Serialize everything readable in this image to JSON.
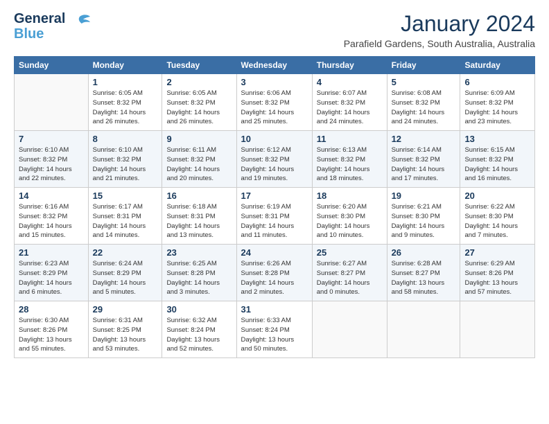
{
  "header": {
    "logo_line1": "General",
    "logo_line2": "Blue",
    "month": "January 2024",
    "location": "Parafield Gardens, South Australia, Australia"
  },
  "columns": [
    "Sunday",
    "Monday",
    "Tuesday",
    "Wednesday",
    "Thursday",
    "Friday",
    "Saturday"
  ],
  "weeks": [
    [
      {
        "day": "",
        "sunrise": "",
        "sunset": "",
        "daylight": ""
      },
      {
        "day": "1",
        "sunrise": "Sunrise: 6:05 AM",
        "sunset": "Sunset: 8:32 PM",
        "daylight": "Daylight: 14 hours and 26 minutes."
      },
      {
        "day": "2",
        "sunrise": "Sunrise: 6:05 AM",
        "sunset": "Sunset: 8:32 PM",
        "daylight": "Daylight: 14 hours and 26 minutes."
      },
      {
        "day": "3",
        "sunrise": "Sunrise: 6:06 AM",
        "sunset": "Sunset: 8:32 PM",
        "daylight": "Daylight: 14 hours and 25 minutes."
      },
      {
        "day": "4",
        "sunrise": "Sunrise: 6:07 AM",
        "sunset": "Sunset: 8:32 PM",
        "daylight": "Daylight: 14 hours and 24 minutes."
      },
      {
        "day": "5",
        "sunrise": "Sunrise: 6:08 AM",
        "sunset": "Sunset: 8:32 PM",
        "daylight": "Daylight: 14 hours and 24 minutes."
      },
      {
        "day": "6",
        "sunrise": "Sunrise: 6:09 AM",
        "sunset": "Sunset: 8:32 PM",
        "daylight": "Daylight: 14 hours and 23 minutes."
      }
    ],
    [
      {
        "day": "7",
        "sunrise": "Sunrise: 6:10 AM",
        "sunset": "Sunset: 8:32 PM",
        "daylight": "Daylight: 14 hours and 22 minutes."
      },
      {
        "day": "8",
        "sunrise": "Sunrise: 6:10 AM",
        "sunset": "Sunset: 8:32 PM",
        "daylight": "Daylight: 14 hours and 21 minutes."
      },
      {
        "day": "9",
        "sunrise": "Sunrise: 6:11 AM",
        "sunset": "Sunset: 8:32 PM",
        "daylight": "Daylight: 14 hours and 20 minutes."
      },
      {
        "day": "10",
        "sunrise": "Sunrise: 6:12 AM",
        "sunset": "Sunset: 8:32 PM",
        "daylight": "Daylight: 14 hours and 19 minutes."
      },
      {
        "day": "11",
        "sunrise": "Sunrise: 6:13 AM",
        "sunset": "Sunset: 8:32 PM",
        "daylight": "Daylight: 14 hours and 18 minutes."
      },
      {
        "day": "12",
        "sunrise": "Sunrise: 6:14 AM",
        "sunset": "Sunset: 8:32 PM",
        "daylight": "Daylight: 14 hours and 17 minutes."
      },
      {
        "day": "13",
        "sunrise": "Sunrise: 6:15 AM",
        "sunset": "Sunset: 8:32 PM",
        "daylight": "Daylight: 14 hours and 16 minutes."
      }
    ],
    [
      {
        "day": "14",
        "sunrise": "Sunrise: 6:16 AM",
        "sunset": "Sunset: 8:32 PM",
        "daylight": "Daylight: 14 hours and 15 minutes."
      },
      {
        "day": "15",
        "sunrise": "Sunrise: 6:17 AM",
        "sunset": "Sunset: 8:31 PM",
        "daylight": "Daylight: 14 hours and 14 minutes."
      },
      {
        "day": "16",
        "sunrise": "Sunrise: 6:18 AM",
        "sunset": "Sunset: 8:31 PM",
        "daylight": "Daylight: 14 hours and 13 minutes."
      },
      {
        "day": "17",
        "sunrise": "Sunrise: 6:19 AM",
        "sunset": "Sunset: 8:31 PM",
        "daylight": "Daylight: 14 hours and 11 minutes."
      },
      {
        "day": "18",
        "sunrise": "Sunrise: 6:20 AM",
        "sunset": "Sunset: 8:30 PM",
        "daylight": "Daylight: 14 hours and 10 minutes."
      },
      {
        "day": "19",
        "sunrise": "Sunrise: 6:21 AM",
        "sunset": "Sunset: 8:30 PM",
        "daylight": "Daylight: 14 hours and 9 minutes."
      },
      {
        "day": "20",
        "sunrise": "Sunrise: 6:22 AM",
        "sunset": "Sunset: 8:30 PM",
        "daylight": "Daylight: 14 hours and 7 minutes."
      }
    ],
    [
      {
        "day": "21",
        "sunrise": "Sunrise: 6:23 AM",
        "sunset": "Sunset: 8:29 PM",
        "daylight": "Daylight: 14 hours and 6 minutes."
      },
      {
        "day": "22",
        "sunrise": "Sunrise: 6:24 AM",
        "sunset": "Sunset: 8:29 PM",
        "daylight": "Daylight: 14 hours and 5 minutes."
      },
      {
        "day": "23",
        "sunrise": "Sunrise: 6:25 AM",
        "sunset": "Sunset: 8:28 PM",
        "daylight": "Daylight: 14 hours and 3 minutes."
      },
      {
        "day": "24",
        "sunrise": "Sunrise: 6:26 AM",
        "sunset": "Sunset: 8:28 PM",
        "daylight": "Daylight: 14 hours and 2 minutes."
      },
      {
        "day": "25",
        "sunrise": "Sunrise: 6:27 AM",
        "sunset": "Sunset: 8:27 PM",
        "daylight": "Daylight: 14 hours and 0 minutes."
      },
      {
        "day": "26",
        "sunrise": "Sunrise: 6:28 AM",
        "sunset": "Sunset: 8:27 PM",
        "daylight": "Daylight: 13 hours and 58 minutes."
      },
      {
        "day": "27",
        "sunrise": "Sunrise: 6:29 AM",
        "sunset": "Sunset: 8:26 PM",
        "daylight": "Daylight: 13 hours and 57 minutes."
      }
    ],
    [
      {
        "day": "28",
        "sunrise": "Sunrise: 6:30 AM",
        "sunset": "Sunset: 8:26 PM",
        "daylight": "Daylight: 13 hours and 55 minutes."
      },
      {
        "day": "29",
        "sunrise": "Sunrise: 6:31 AM",
        "sunset": "Sunset: 8:25 PM",
        "daylight": "Daylight: 13 hours and 53 minutes."
      },
      {
        "day": "30",
        "sunrise": "Sunrise: 6:32 AM",
        "sunset": "Sunset: 8:24 PM",
        "daylight": "Daylight: 13 hours and 52 minutes."
      },
      {
        "day": "31",
        "sunrise": "Sunrise: 6:33 AM",
        "sunset": "Sunset: 8:24 PM",
        "daylight": "Daylight: 13 hours and 50 minutes."
      },
      {
        "day": "",
        "sunrise": "",
        "sunset": "",
        "daylight": ""
      },
      {
        "day": "",
        "sunrise": "",
        "sunset": "",
        "daylight": ""
      },
      {
        "day": "",
        "sunrise": "",
        "sunset": "",
        "daylight": ""
      }
    ]
  ]
}
